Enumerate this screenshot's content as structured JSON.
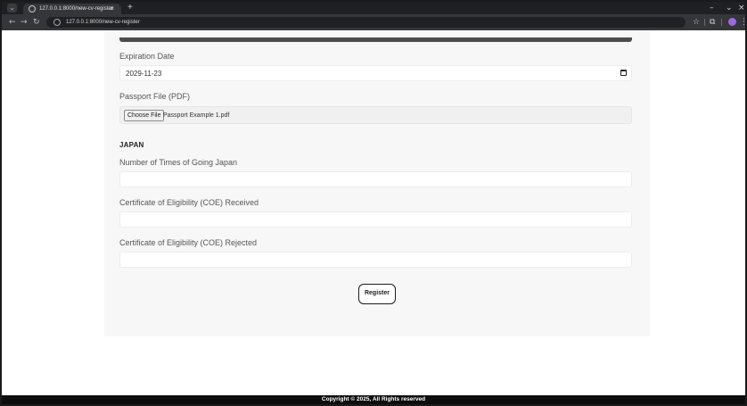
{
  "browser": {
    "tab": {
      "title": "127.0.0.1:8000/new-cv-register",
      "close_glyph": "×"
    },
    "new_tab_glyph": "+",
    "menu_glyph": "⌄",
    "window_controls": {
      "minimize": "–",
      "maximize": "⌄",
      "close": "×"
    },
    "nav": {
      "back": "←",
      "forward": "→",
      "reload": "↻"
    },
    "url": "127.0.0.1:8000/new-cv-register",
    "toolbar_icons": {
      "bookmark": "☆",
      "extensions": "⧉",
      "menu": "⋮"
    }
  },
  "form": {
    "expiration_date": {
      "label": "Expiration Date",
      "value": "2029-11-23"
    },
    "passport_file": {
      "label": "Passport File (PDF)",
      "button_label": "Choose File",
      "file_name": "Passport Example 1.pdf"
    },
    "japan_section": {
      "heading": "JAPAN",
      "times_going_japan": {
        "label": "Number of Times of Going Japan",
        "value": ""
      },
      "coe_received": {
        "label": "Certificate of Eligibility (COE) Received",
        "value": ""
      },
      "coe_rejected": {
        "label": "Certificate of Eligibility (COE) Rejected",
        "value": ""
      }
    },
    "register_label": "Register"
  },
  "footer": {
    "copyright": "Copyright © 2025, All Rights reserved"
  },
  "colors": {
    "browser_chrome": "#35363a",
    "tab_strip": "#1f2024",
    "card_background": "#f7f7f7",
    "footer_background": "#0d0d0d"
  }
}
